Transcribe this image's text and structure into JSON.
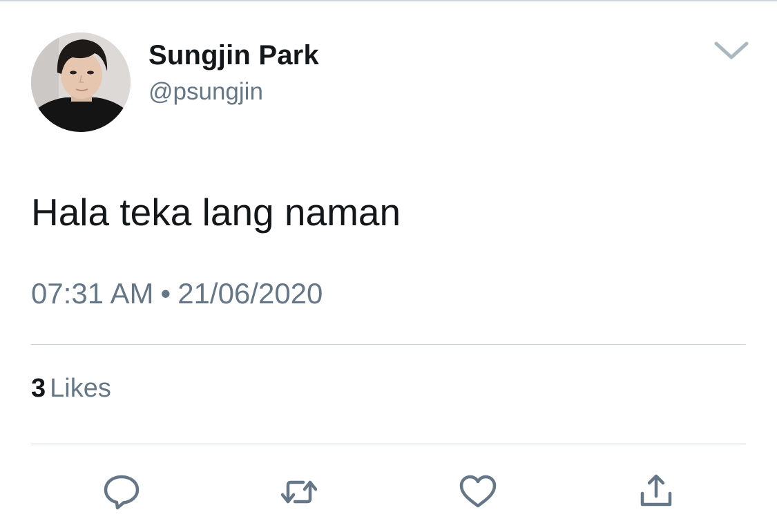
{
  "user": {
    "display_name": "Sungjin Park",
    "handle": "@psungjin",
    "avatar_icon": "profile-photo"
  },
  "tweet": {
    "text": "Hala teka lang naman",
    "time": "07:31 AM",
    "separator": "•",
    "date": "21/06/2020"
  },
  "stats": {
    "likes_count": "3",
    "likes_label": "Likes"
  },
  "actions": {
    "reply_icon": "reply-icon",
    "retweet_icon": "retweet-icon",
    "like_icon": "heart-icon",
    "share_icon": "share-icon"
  },
  "colors": {
    "text_primary": "#14171a",
    "text_secondary": "#657786",
    "icon": "#657786",
    "divider": "#cfd5da"
  }
}
